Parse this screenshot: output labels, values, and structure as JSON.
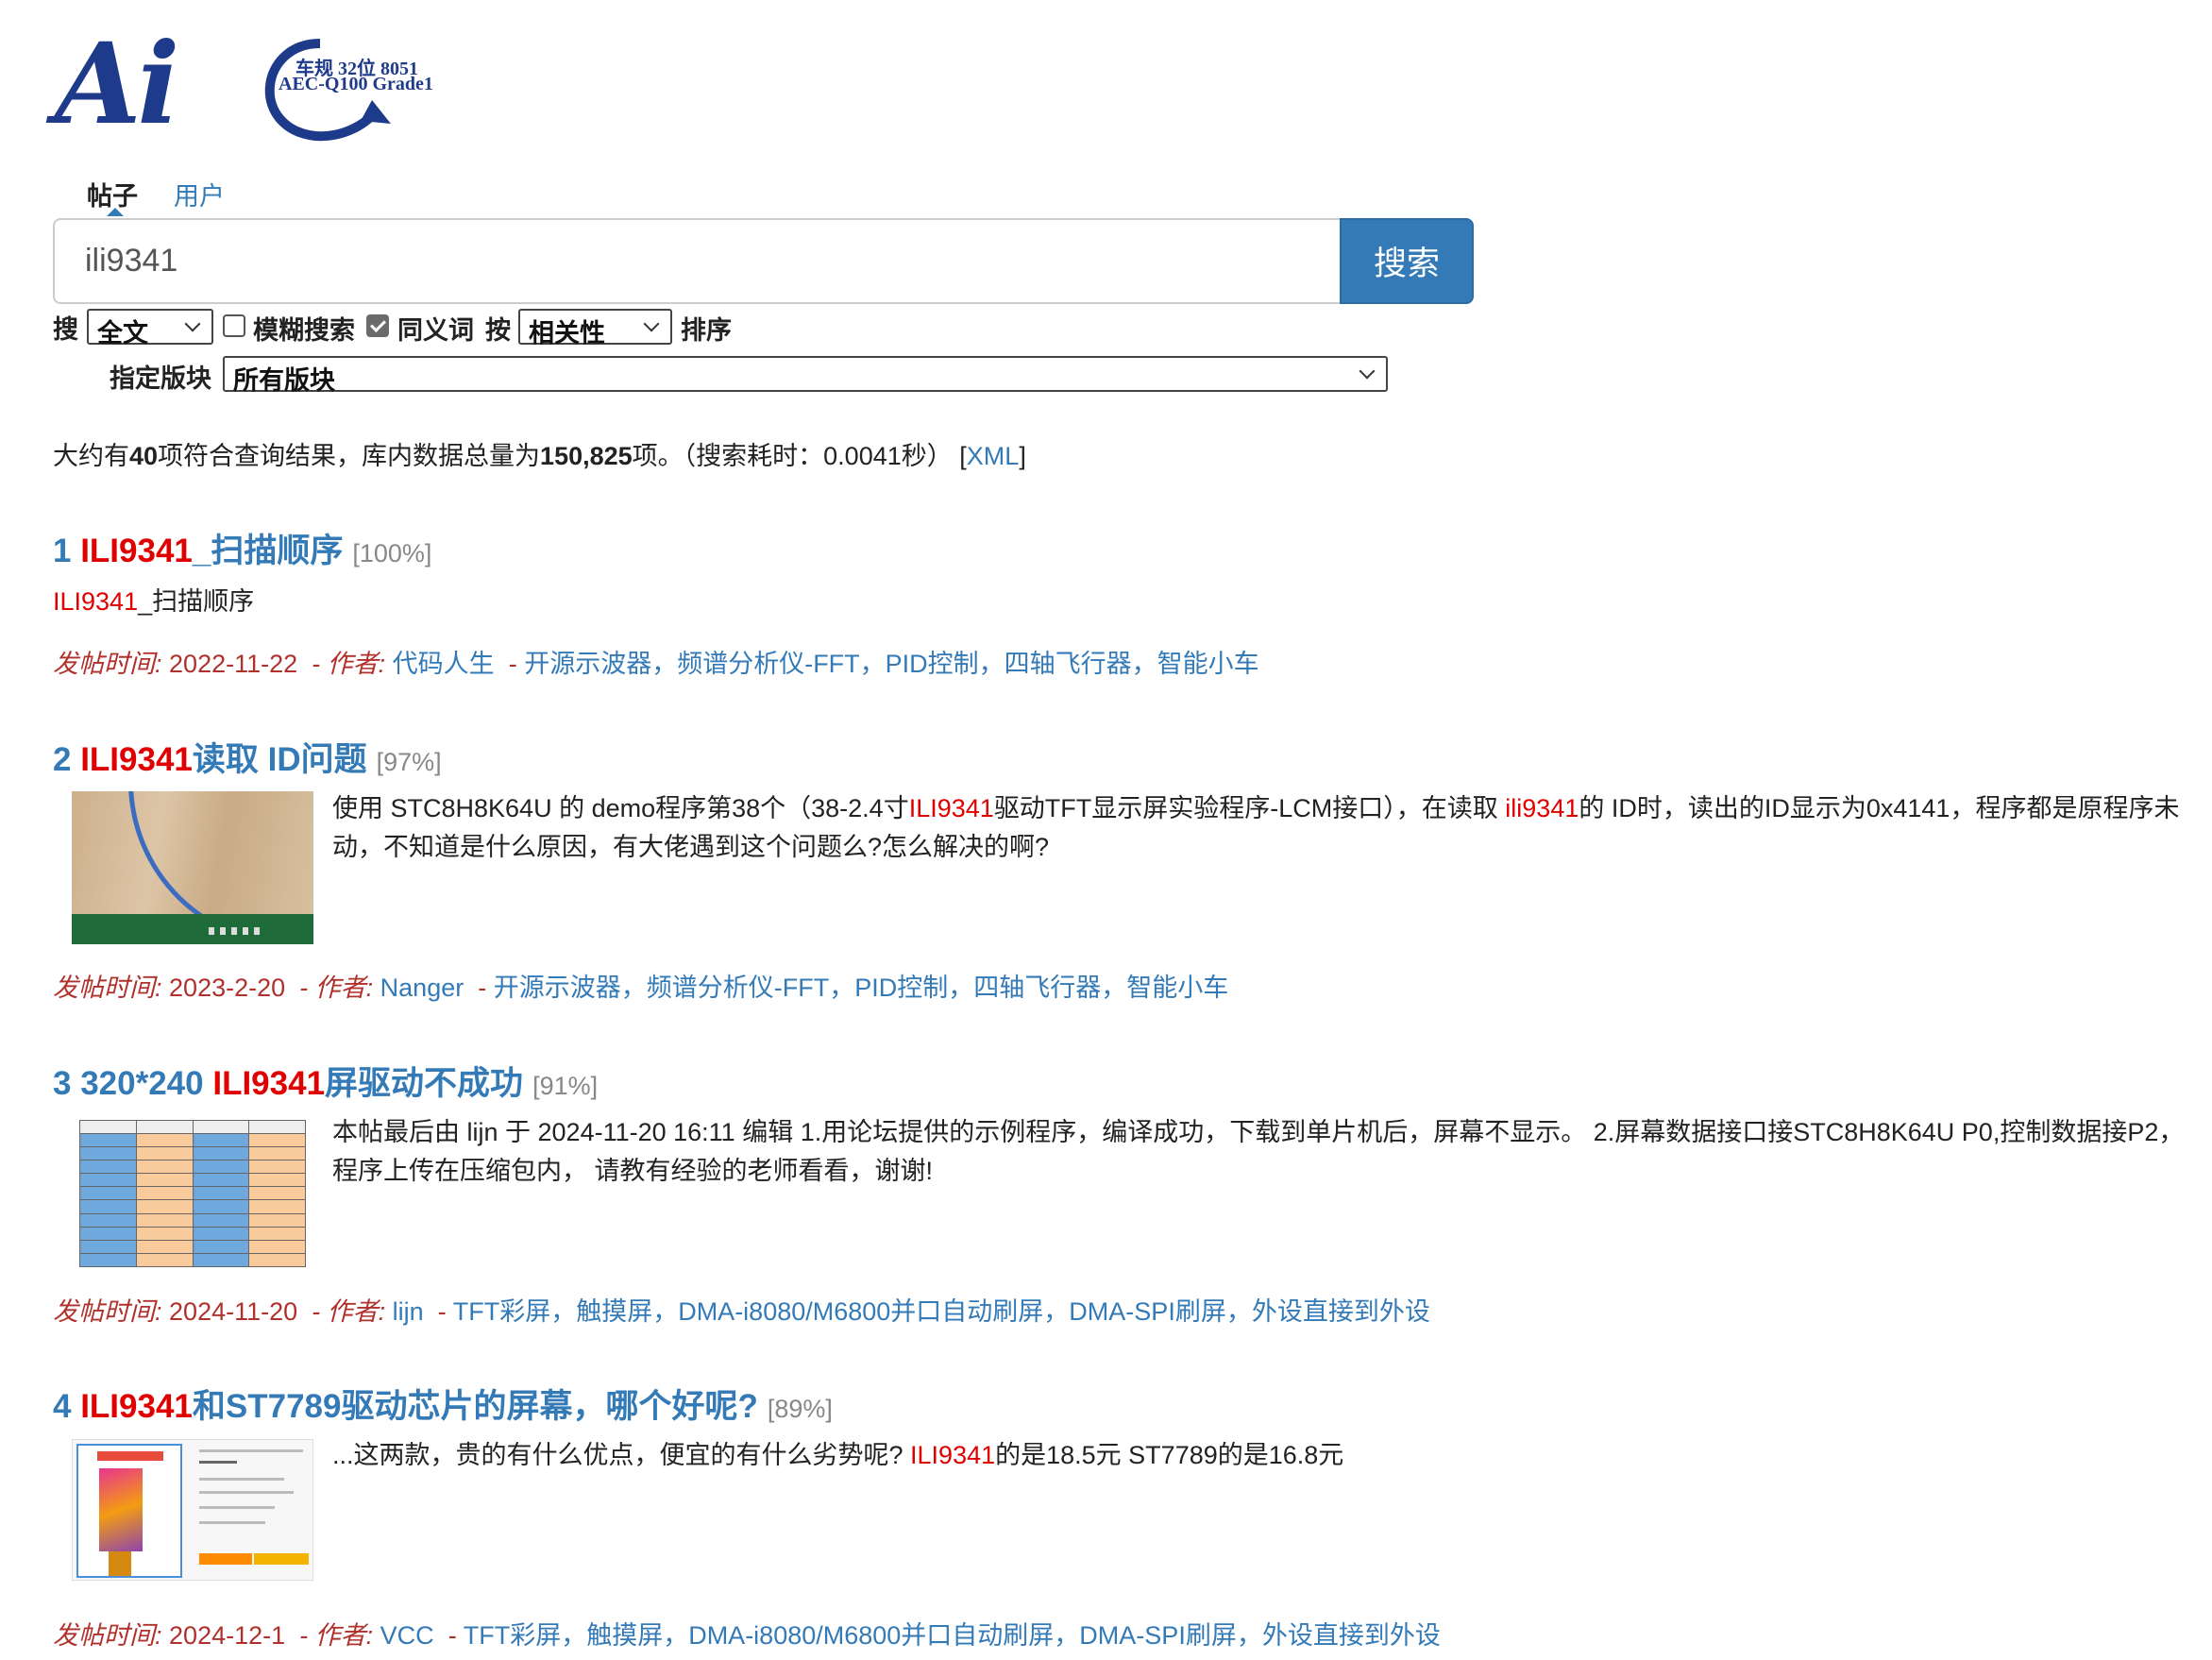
{
  "logo": {
    "mark": "Ai",
    "line1": "车规 32位 8051",
    "line2": "AEC-Q100 Grade1"
  },
  "tabs": {
    "posts": "帖子",
    "users": "用户"
  },
  "search": {
    "query": "ili9341",
    "button": "搜索"
  },
  "options": {
    "search_prefix": "搜",
    "scope_select": "全文",
    "fuzzy_label": "模糊搜索",
    "fuzzy_checked": false,
    "synonym_label": "同义词",
    "synonym_checked": true,
    "sort_prefix": "按",
    "sort_select": "相关性",
    "sort_suffix": "排序",
    "forum_label": "指定版块",
    "forum_select": "所有版块"
  },
  "summary": {
    "pre": "大约有",
    "count": "40",
    "mid": "项符合查询结果，库内数据总量为",
    "total": "150,825",
    "post": "项。（搜索耗时：0.0041秒）",
    "xml_open": "[",
    "xml_link": "XML",
    "xml_close": "]"
  },
  "meta_labels": {
    "posted": "发帖时间:",
    "author": "- 作者:",
    "dash": "-"
  },
  "results": [
    {
      "num": "1",
      "title_hl": "ILI9341",
      "title_rest": "_扫描顺序",
      "score": "[100%]",
      "snippet_hl": "ILI9341",
      "snippet_rest": "_扫描顺序",
      "date": "2022-11-22",
      "author": "代码人生",
      "categories": "开源示波器，频谱分析仪-FFT，PID控制，四轴飞行器，智能小车"
    },
    {
      "num": "2",
      "title_hl": "ILI9341",
      "title_rest": "读取 ID问题",
      "score": "[97%]",
      "snippet_a": "使用 STC8H8K64U 的 demo程序第38个（38-2.4寸",
      "snippet_hl1": "ILI9341",
      "snippet_b": "驱动TFT显示屏实验程序-LCM接口），在读取 ",
      "snippet_hl2": "ili9341",
      "snippet_c": "的 ID时，读出的ID显示为0x4141，程序都是原程序未动，不知道是什么原因，有大佬遇到这个问题么?怎么解决的啊?",
      "date": "2023-2-20",
      "author": "Nanger",
      "categories": "开源示波器，频谱分析仪-FFT，PID控制，四轴飞行器，智能小车"
    },
    {
      "num": "3",
      "title_pre": "320*240 ",
      "title_hl": "ILI9341",
      "title_rest": "屏驱动不成功",
      "score": "[91%]",
      "snippet": "本帖最后由 lijn 于 2024-11-20 16:11 编辑 1.用论坛提供的示例程序，编译成功，下载到单片机后，屏幕不显示。 2.屏幕数据接口接STC8H8K64U P0,控制数据接P2，程序上传在压缩包内， 请教有经验的老师看看，谢谢!",
      "date": "2024-11-20",
      "author": "lijn",
      "categories": "TFT彩屏，触摸屏，DMA-i8080/M6800并口自动刷屏，DMA-SPI刷屏，外设直接到外设"
    },
    {
      "num": "4",
      "title_hl": "ILI9341",
      "title_rest": "和ST7789驱动芯片的屏幕，哪个好呢?",
      "score": "[89%]",
      "snippet_a": "...这两款，贵的有什么优点，便宜的有什么劣势呢? ",
      "snippet_hl": "ILI9341",
      "snippet_b": "的是18.5元 ST7789的是16.8元",
      "date": "2024-12-1",
      "author": "VCC",
      "categories": "TFT彩屏，触摸屏，DMA-i8080/M6800并口自动刷屏，DMA-SPI刷屏，外设直接到外设"
    }
  ],
  "colors": {
    "link": "#337ab7",
    "highlight": "#e00000",
    "meta": "#b0302b",
    "button": "#337ab7"
  }
}
